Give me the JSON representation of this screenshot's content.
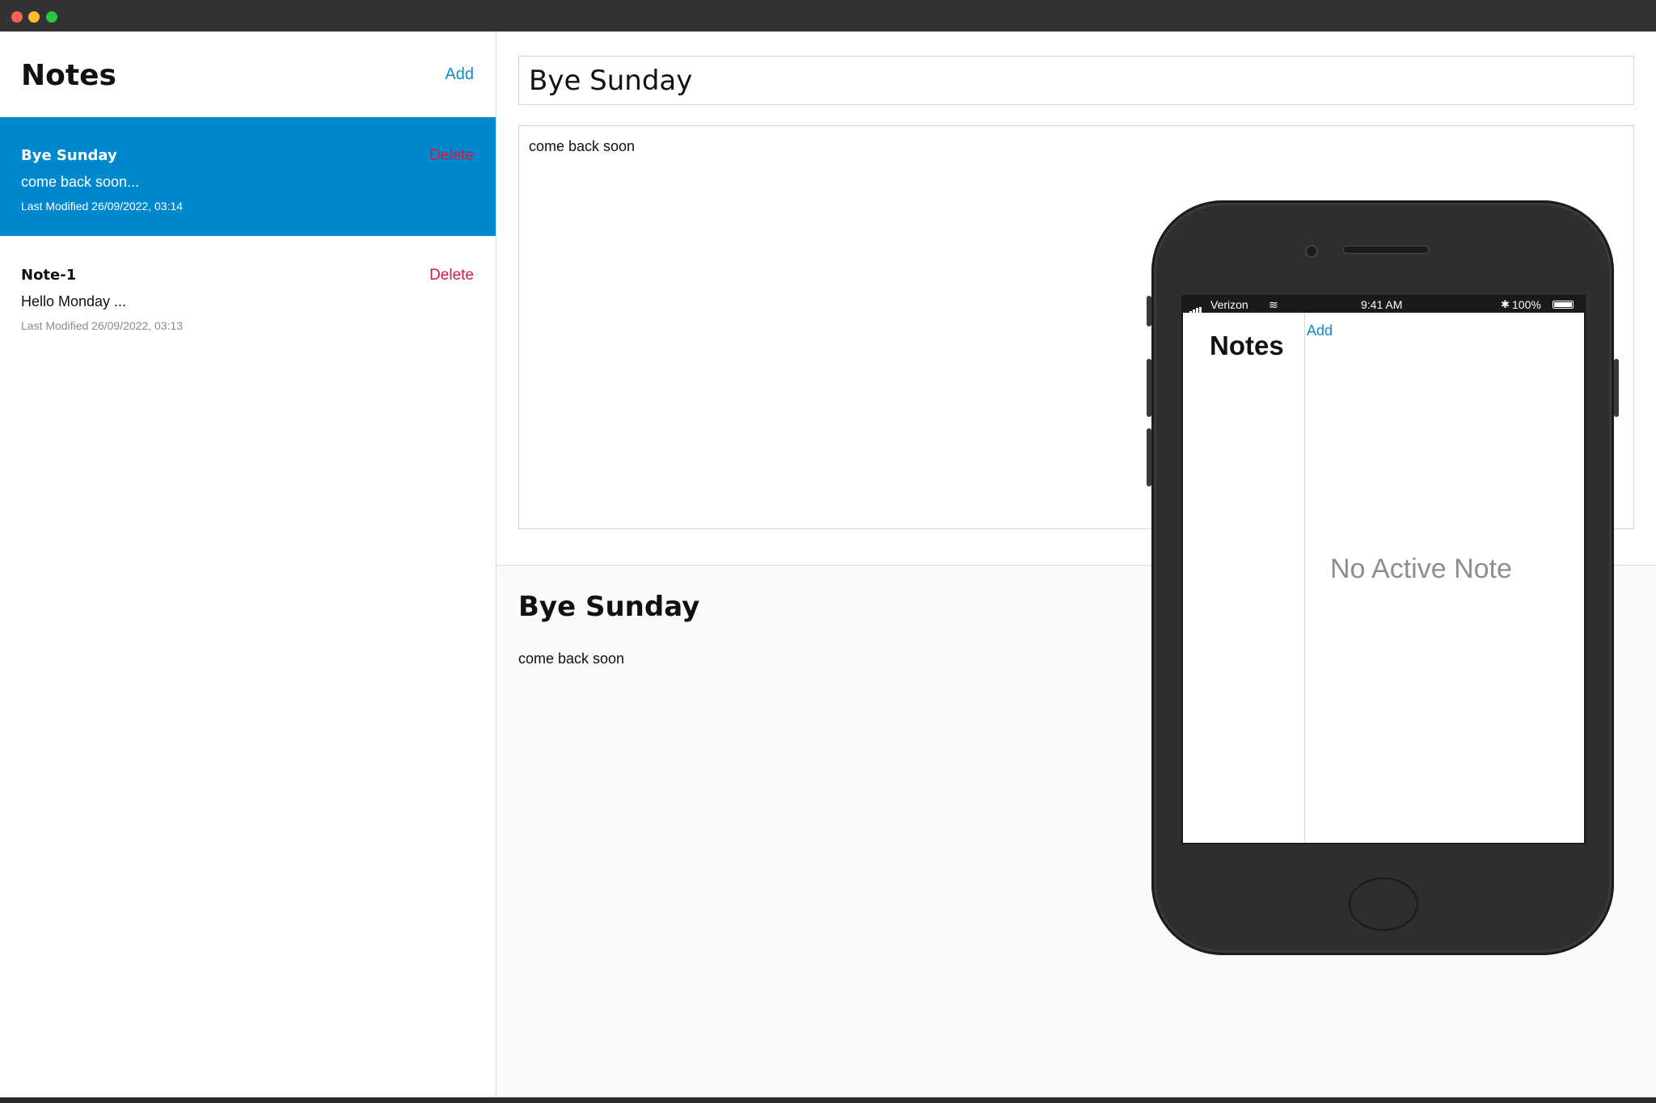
{
  "window": {
    "controls": [
      "close",
      "minimize",
      "zoom"
    ]
  },
  "sidebar": {
    "title": "Notes",
    "add_label": "Add",
    "notes": [
      {
        "title": "Bye Sunday",
        "preview": "come back soon...",
        "modified": "Last Modified 26/09/2022, 03:14",
        "delete_label": "Delete",
        "active": true
      },
      {
        "title": "Note-1",
        "preview": "Hello Monday ...",
        "modified": "Last Modified 26/09/2022, 03:13",
        "delete_label": "Delete",
        "active": false
      }
    ]
  },
  "editor": {
    "title_value": "Bye Sunday",
    "body_value": "come back soon"
  },
  "preview": {
    "title": "Bye Sunday",
    "body": "come back soon"
  },
  "phone": {
    "status": {
      "carrier": "Verizon",
      "time": "9:41 AM",
      "battery": "100%"
    },
    "title": "Notes",
    "add_label": "Add",
    "empty_message": "No Active Note"
  },
  "colors": {
    "accent": "#0088cf",
    "link": "#1489c8",
    "delete": "#d7193f"
  }
}
